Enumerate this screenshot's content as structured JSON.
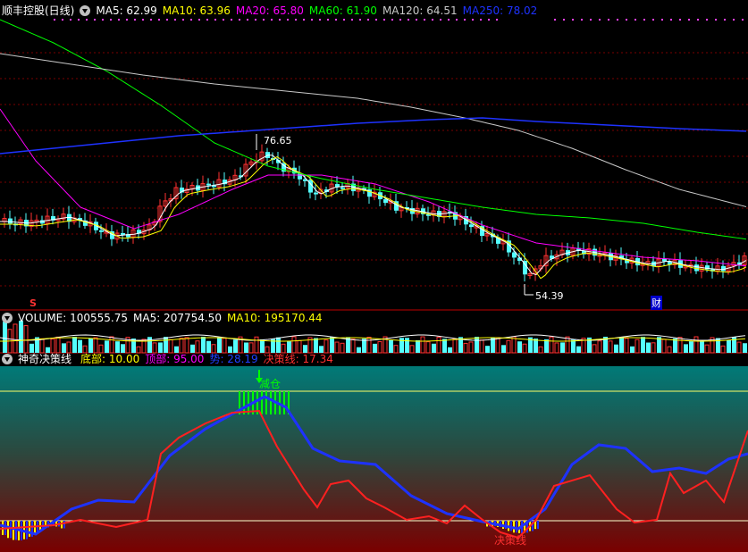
{
  "main": {
    "title": "顺丰控股(日线)",
    "ma": [
      {
        "label": "MA5: 62.99",
        "color": "#ffffff"
      },
      {
        "label": "MA10: 63.96",
        "color": "#ffff00"
      },
      {
        "label": "MA20: 65.80",
        "color": "#ff00ff"
      },
      {
        "label": "MA60: 61.90",
        "color": "#00ff00"
      },
      {
        "label": "MA120: 64.51",
        "color": "#c8c8c8"
      },
      {
        "label": "MA250: 78.02",
        "color": "#1e32ff"
      }
    ],
    "high_label": "76.65",
    "low_label": "54.39",
    "cai_label": "财",
    "s_label": "S"
  },
  "volume": {
    "items": [
      {
        "label": "VOLUME: 100555.75",
        "color": "#ffffff"
      },
      {
        "label": "MA5: 207754.50",
        "color": "#ffffff"
      },
      {
        "label": "MA10: 195170.44",
        "color": "#ffff00"
      }
    ]
  },
  "indicator": {
    "name": "神奇决策线",
    "items": [
      {
        "label": "底部: 10.00",
        "color": "#ffff00"
      },
      {
        "label": "顶部: 95.00",
        "color": "#ff00ff"
      },
      {
        "label": "势: 28.19",
        "color": "#2040ff"
      },
      {
        "label": "决策线: 17.34",
        "color": "#ff3030"
      }
    ],
    "reduce_label": "减仓",
    "decision_label": "决策线"
  },
  "colors": {
    "up": "#ff3232",
    "down": "#54ffff",
    "grid": "#7a0000"
  }
}
